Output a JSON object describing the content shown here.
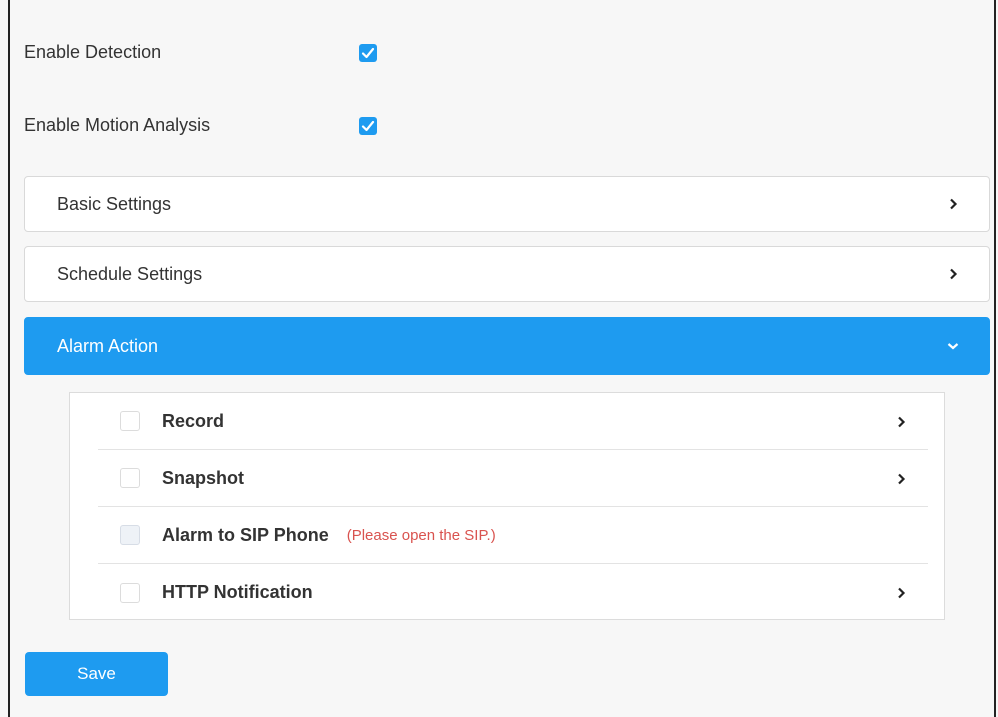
{
  "toggles": {
    "enable_detection": {
      "label": "Enable Detection",
      "checked": true
    },
    "enable_motion_analysis": {
      "label": "Enable Motion Analysis",
      "checked": true
    }
  },
  "panels": {
    "basic_settings": {
      "label": "Basic Settings",
      "icon": "chevron-right-icon"
    },
    "schedule_settings": {
      "label": "Schedule Settings",
      "icon": "chevron-right-icon"
    },
    "alarm_action": {
      "label": "Alarm Action",
      "icon": "chevron-down-icon",
      "expanded": true
    }
  },
  "alarm_actions": {
    "record": {
      "label": "Record",
      "checked": false
    },
    "snapshot": {
      "label": "Snapshot",
      "checked": false
    },
    "alarm_to_sip": {
      "label": "Alarm to SIP Phone",
      "note": "(Please open the SIP.)",
      "disabled": true
    },
    "http_notification": {
      "label": "HTTP Notification",
      "checked": false
    }
  },
  "buttons": {
    "save": "Save"
  },
  "colors": {
    "accent": "#1e9bf0",
    "warning_text": "#d9534f"
  }
}
